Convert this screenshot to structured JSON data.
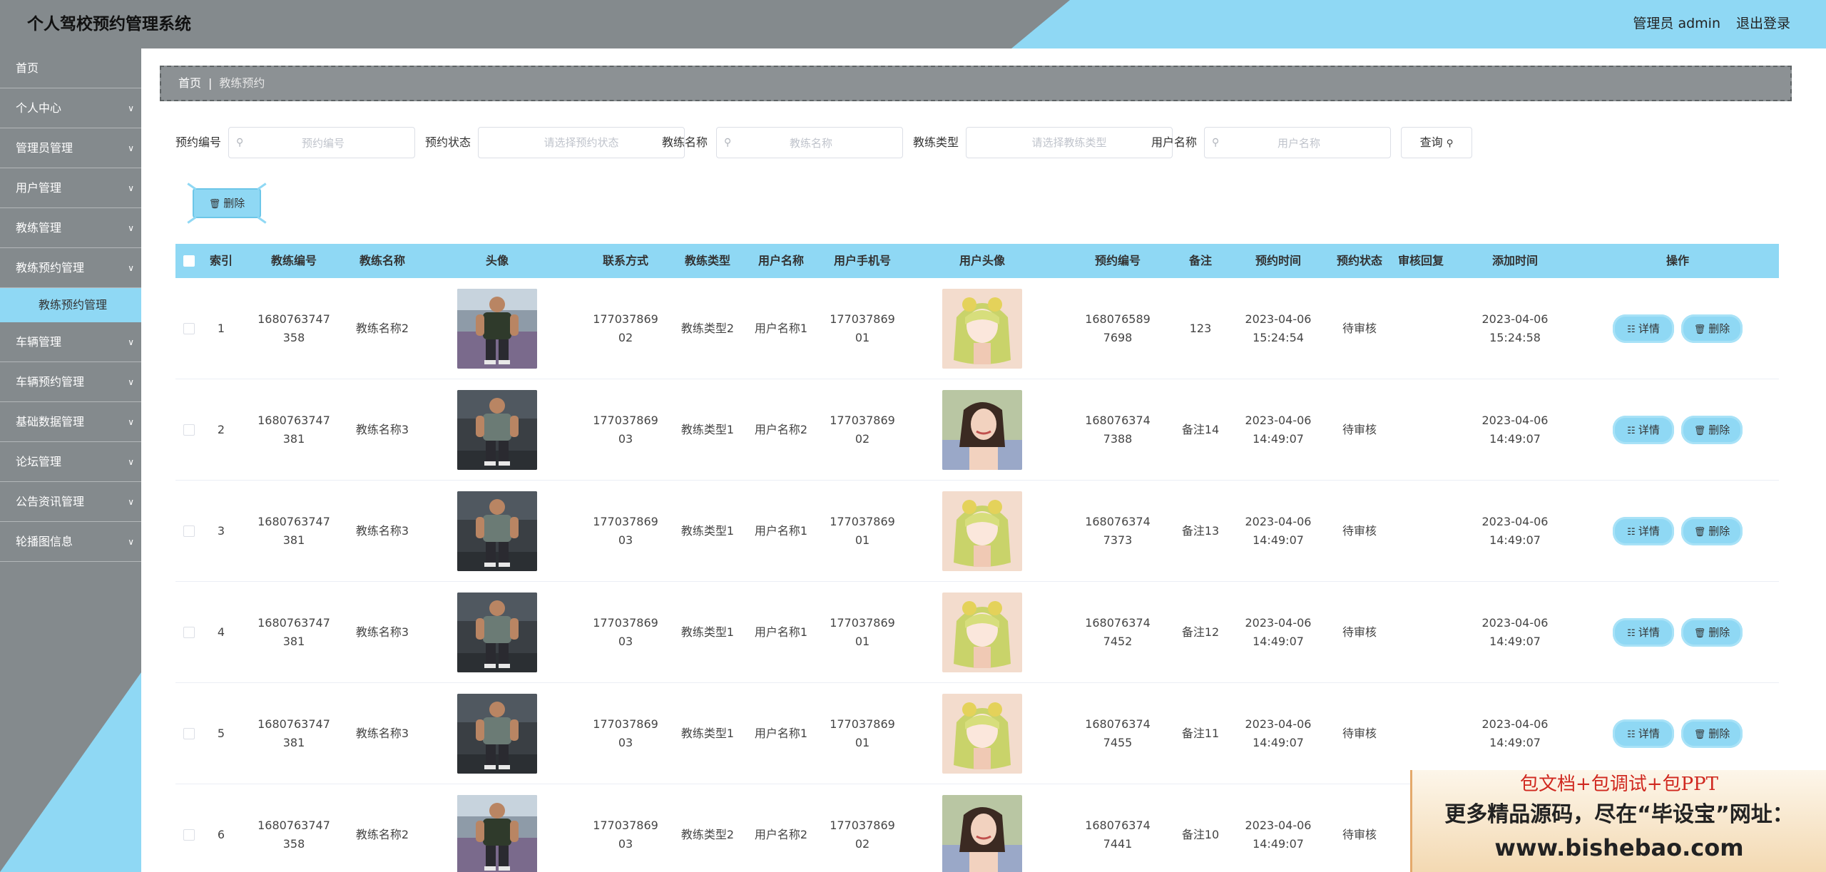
{
  "header": {
    "title": "个人驾校预约管理系统",
    "user": "管理员 admin",
    "logout": "退出登录"
  },
  "sidebar": {
    "items": [
      {
        "label": "首页",
        "chev": false
      },
      {
        "label": "个人中心",
        "chev": true
      },
      {
        "label": "管理员管理",
        "chev": true
      },
      {
        "label": "用户管理",
        "chev": true
      },
      {
        "label": "教练管理",
        "chev": true
      },
      {
        "label": "教练预约管理",
        "chev": true
      },
      {
        "label": "车辆管理",
        "chev": true
      },
      {
        "label": "车辆预约管理",
        "chev": true
      },
      {
        "label": "基础数据管理",
        "chev": true
      },
      {
        "label": "论坛管理",
        "chev": true
      },
      {
        "label": "公告资讯管理",
        "chev": true
      },
      {
        "label": "轮播图信息",
        "chev": true
      }
    ],
    "active_sub": "教练预约管理"
  },
  "breadcrumb": {
    "home": "首页",
    "separator": "|",
    "current": "教练预约"
  },
  "filters": {
    "booking_no_label": "预约编号",
    "booking_no_placeholder": "预约编号",
    "status_label": "预约状态",
    "status_placeholder": "请选择预约状态",
    "coach_name_label": "教练名称",
    "coach_name_placeholder": "教练名称",
    "coach_type_label": "教练类型",
    "coach_type_placeholder": "请选择教练类型",
    "user_name_label": "用户名称",
    "user_name_placeholder": "用户名称",
    "query_label": "查询"
  },
  "bulk_delete_label": "删除",
  "table": {
    "columns": [
      "索引",
      "教练编号",
      "教练名称",
      "头像",
      "联系方式",
      "教练类型",
      "用户名称",
      "用户手机号",
      "用户头像",
      "预约编号",
      "备注",
      "预约时间",
      "预约状态",
      "审核回复",
      "添加时间",
      "操作"
    ],
    "detail_label": "详情",
    "delete_label": "删除",
    "rows": [
      {
        "index": "1",
        "coach_no_a": "1680763747",
        "coach_no_b": "358",
        "coach_name": "教练名称2",
        "phone_a": "177037869",
        "phone_b": "02",
        "coach_type": "教练类型2",
        "user_name": "用户名称1",
        "user_phone_a": "177037869",
        "user_phone_b": "01",
        "booking_no_a": "168076589",
        "booking_no_b": "7698",
        "note": "123",
        "book_date": "2023-04-06",
        "book_time": "15:24:54",
        "status": "待审核",
        "reply": "",
        "add_date": "2023-04-06",
        "add_time": "15:24:58",
        "coach_img": "gym-vest",
        "user_img": "anime"
      },
      {
        "index": "2",
        "coach_no_a": "1680763747",
        "coach_no_b": "381",
        "coach_name": "教练名称3",
        "phone_a": "177037869",
        "phone_b": "03",
        "coach_type": "教练类型1",
        "user_name": "用户名称2",
        "user_phone_a": "177037869",
        "user_phone_b": "02",
        "booking_no_a": "168076374",
        "booking_no_b": "7388",
        "note": "备注14",
        "book_date": "2023-04-06",
        "book_time": "14:49:07",
        "status": "待审核",
        "reply": "",
        "add_date": "2023-04-06",
        "add_time": "14:49:07",
        "coach_img": "gym-tank",
        "user_img": "girl"
      },
      {
        "index": "3",
        "coach_no_a": "1680763747",
        "coach_no_b": "381",
        "coach_name": "教练名称3",
        "phone_a": "177037869",
        "phone_b": "03",
        "coach_type": "教练类型1",
        "user_name": "用户名称1",
        "user_phone_a": "177037869",
        "user_phone_b": "01",
        "booking_no_a": "168076374",
        "booking_no_b": "7373",
        "note": "备注13",
        "book_date": "2023-04-06",
        "book_time": "14:49:07",
        "status": "待审核",
        "reply": "",
        "add_date": "2023-04-06",
        "add_time": "14:49:07",
        "coach_img": "gym-tank",
        "user_img": "anime"
      },
      {
        "index": "4",
        "coach_no_a": "1680763747",
        "coach_no_b": "381",
        "coach_name": "教练名称3",
        "phone_a": "177037869",
        "phone_b": "03",
        "coach_type": "教练类型1",
        "user_name": "用户名称1",
        "user_phone_a": "177037869",
        "user_phone_b": "01",
        "booking_no_a": "168076374",
        "booking_no_b": "7452",
        "note": "备注12",
        "book_date": "2023-04-06",
        "book_time": "14:49:07",
        "status": "待审核",
        "reply": "",
        "add_date": "2023-04-06",
        "add_time": "14:49:07",
        "coach_img": "gym-tank",
        "user_img": "anime"
      },
      {
        "index": "5",
        "coach_no_a": "1680763747",
        "coach_no_b": "381",
        "coach_name": "教练名称3",
        "phone_a": "177037869",
        "phone_b": "03",
        "coach_type": "教练类型1",
        "user_name": "用户名称1",
        "user_phone_a": "177037869",
        "user_phone_b": "01",
        "booking_no_a": "168076374",
        "booking_no_b": "7455",
        "note": "备注11",
        "book_date": "2023-04-06",
        "book_time": "14:49:07",
        "status": "待审核",
        "reply": "",
        "add_date": "2023-04-06",
        "add_time": "14:49:07",
        "coach_img": "gym-tank",
        "user_img": "anime"
      },
      {
        "index": "6",
        "coach_no_a": "1680763747",
        "coach_no_b": "358",
        "coach_name": "教练名称2",
        "phone_a": "177037869",
        "phone_b": "03",
        "coach_type": "教练类型2",
        "user_name": "用户名称2",
        "user_phone_a": "177037869",
        "user_phone_b": "02",
        "booking_no_a": "168076374",
        "booking_no_b": "7441",
        "note": "备注10",
        "book_date": "2023-04-06",
        "book_time": "14:49:07",
        "status": "待审核",
        "reply": "",
        "add_date": "",
        "add_time": "",
        "coach_img": "gym-vest",
        "user_img": "girl"
      }
    ]
  },
  "watermark": {
    "line1": "包文档+包调试+包PPT",
    "line2": "更多精品源码，尽在“毕设宝”网址：",
    "line3": "www.bishebao.com"
  },
  "colors": {
    "accent": "#8fd8f4",
    "chrome": "#848a8d"
  }
}
